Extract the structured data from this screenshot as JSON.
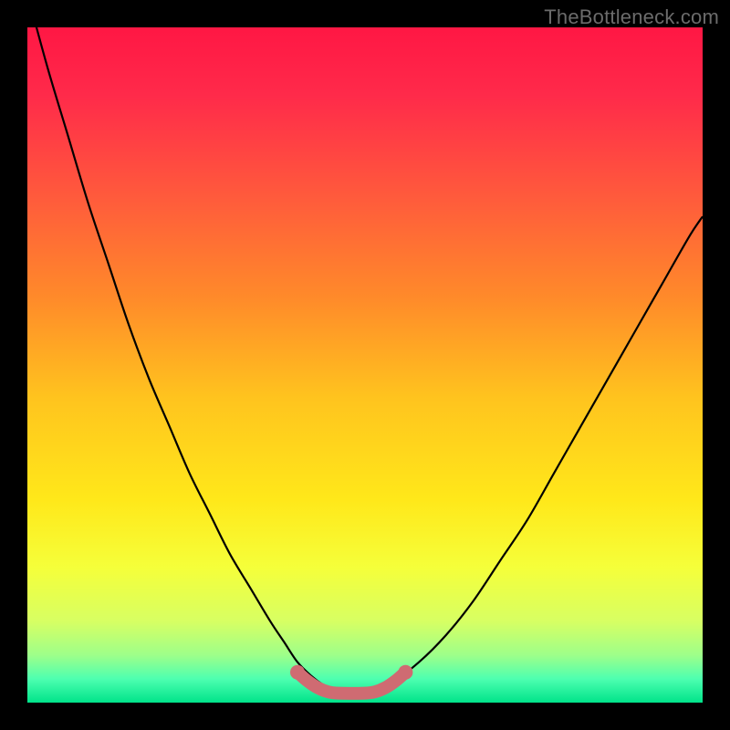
{
  "watermark": "TheBottleneck.com",
  "colors": {
    "frame": "#000000",
    "curve": "#000000",
    "marker": "#cf6b72",
    "gradient_stops": [
      {
        "offset": 0.0,
        "color": "#ff1744"
      },
      {
        "offset": 0.1,
        "color": "#ff2a4a"
      },
      {
        "offset": 0.25,
        "color": "#ff5a3c"
      },
      {
        "offset": 0.4,
        "color": "#ff8a2a"
      },
      {
        "offset": 0.55,
        "color": "#ffc41e"
      },
      {
        "offset": 0.7,
        "color": "#ffe81a"
      },
      {
        "offset": 0.8,
        "color": "#f5ff3a"
      },
      {
        "offset": 0.88,
        "color": "#d7ff63"
      },
      {
        "offset": 0.93,
        "color": "#9dff8a"
      },
      {
        "offset": 0.965,
        "color": "#4dffb0"
      },
      {
        "offset": 1.0,
        "color": "#00e38a"
      }
    ]
  },
  "chart_data": {
    "type": "line",
    "title": "",
    "xlabel": "",
    "ylabel": "",
    "xlim": [
      0,
      100
    ],
    "ylim": [
      0,
      100
    ],
    "grid": false,
    "legend": false,
    "series": [
      {
        "name": "bottleneck-curve",
        "x": [
          0,
          3,
          6,
          9,
          12,
          15,
          18,
          21,
          24,
          27,
          30,
          33,
          36,
          38,
          40,
          42,
          44,
          46,
          50,
          54,
          58,
          62,
          66,
          70,
          74,
          78,
          82,
          86,
          90,
          94,
          98,
          100
        ],
        "y": [
          105,
          94,
          84,
          74,
          65,
          56,
          48,
          41,
          34,
          28,
          22,
          17,
          12,
          9,
          6,
          4,
          2.5,
          1.5,
          1.5,
          3,
          6,
          10,
          15,
          21,
          27,
          34,
          41,
          48,
          55,
          62,
          69,
          72
        ]
      }
    ],
    "markers": {
      "name": "optimal-range",
      "x": [
        40,
        41.5,
        43,
        44.5,
        46,
        50,
        51.5,
        53,
        54.5,
        56
      ],
      "y": [
        4.5,
        3.2,
        2.2,
        1.6,
        1.4,
        1.4,
        1.6,
        2.2,
        3.2,
        4.5
      ]
    }
  }
}
